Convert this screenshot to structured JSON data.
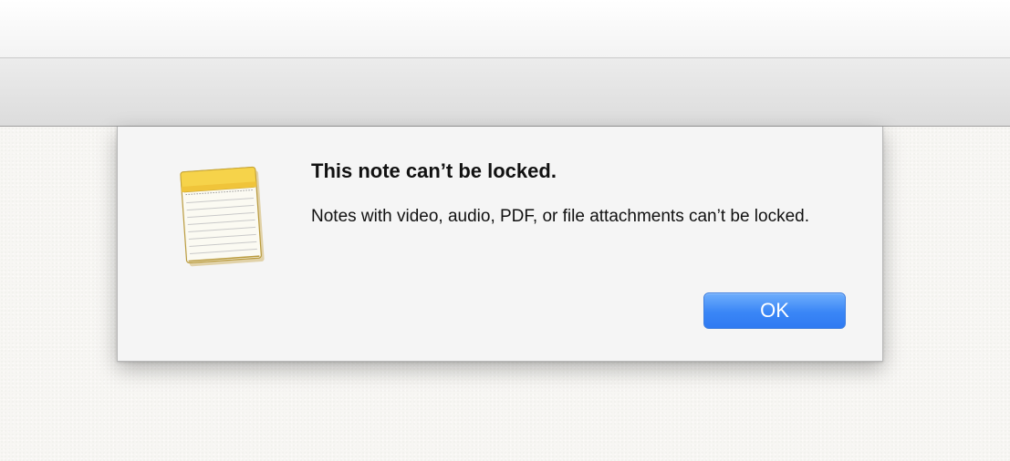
{
  "alert": {
    "title": "This note can’t be locked.",
    "message": "Notes with video, audio, PDF, or file attachments can’t be locked.",
    "ok_label": "OK",
    "icon": "notes-app-icon"
  },
  "colors": {
    "button_accent": "#3a86f6",
    "icon_header": "#f6d34a"
  }
}
